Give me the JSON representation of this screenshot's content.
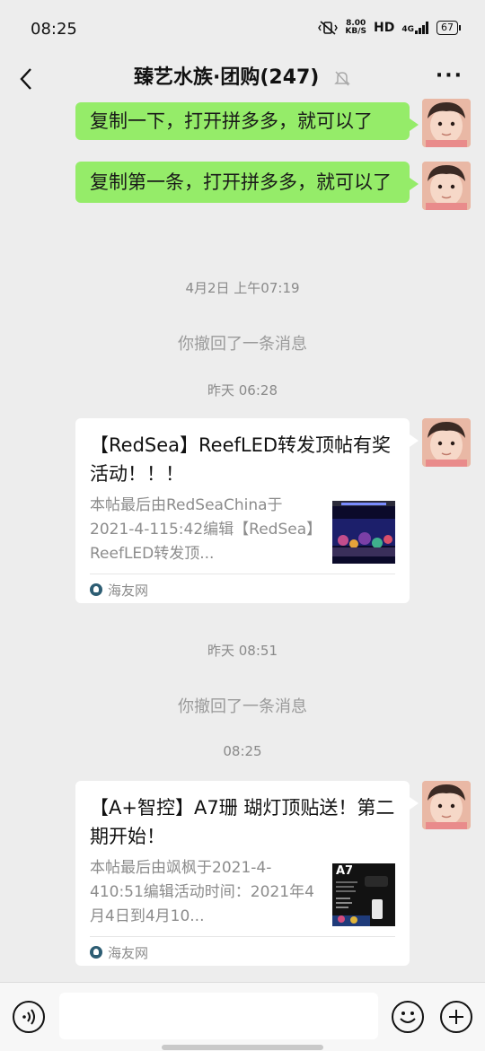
{
  "status_bar": {
    "time": "08:25",
    "speed_value": "8.00",
    "speed_unit": "KB/S",
    "hd": "HD",
    "network": "4G",
    "battery": "67"
  },
  "header": {
    "title": "臻艺水族·团购(247)",
    "more": "···"
  },
  "messages": {
    "m1": "复制一下，打开拼多多，就可以了",
    "m2": "复制第一条，打开拼多多，就可以了",
    "ts1": "4月2日 上午07:19",
    "sys1": "你撤回了一条消息",
    "ts2": "昨天 06:28",
    "ts3": "昨天 08:51",
    "sys2": "你撤回了一条消息",
    "ts4": "08:25"
  },
  "card1": {
    "title": "【RedSea】ReefLED转发顶帖有奖活动！！！",
    "desc": "本帖最后由RedSeaChina于2021-4-115:42编辑【RedSea】ReefLED转发顶...",
    "source": "海友网"
  },
  "card2": {
    "title": "【A+智控】A7珊 瑚灯顶贴送！第二期开始！",
    "desc": "本帖最后由飒枫于2021-4-410:51编辑活动时间：2021年4月4日到4月10...",
    "source": "海友网",
    "thumb_label": "A7"
  },
  "colors": {
    "green_bubble": "#95ec69",
    "background": "#ededed"
  }
}
